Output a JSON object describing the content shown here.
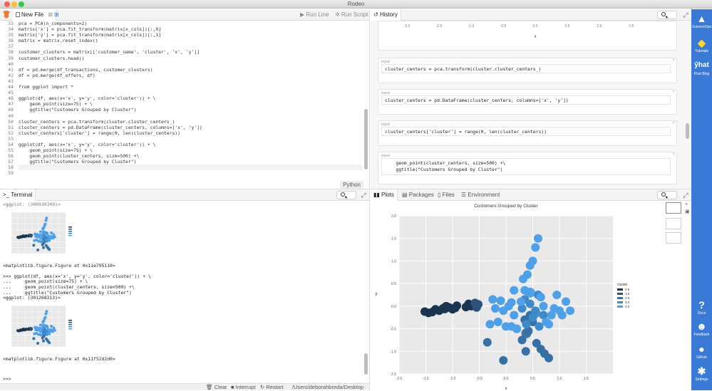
{
  "window": {
    "title": "Rodeo"
  },
  "editor": {
    "tab_label": "New File",
    "run_line": "Run Line",
    "run_script": "Run Script",
    "language": "Python",
    "lines": [
      {
        "n": "33",
        "t": "pca = PCA(n_components=2)"
      },
      {
        "n": "34",
        "t": "matrix['x'] = pca.fit_transform(matrix[x_cols])[:,0]"
      },
      {
        "n": "35",
        "t": "matrix['y'] = pca.fit_transform(matrix[x_cols])[:,1]"
      },
      {
        "n": "36",
        "t": "matrix = matrix.reset_index()"
      },
      {
        "n": "37",
        "t": ""
      },
      {
        "n": "38",
        "t": "customer_clusters = matrix[['customer_name', 'cluster', 'x', 'y']]"
      },
      {
        "n": "39",
        "t": "customer_clusters.head()"
      },
      {
        "n": "40",
        "t": ""
      },
      {
        "n": "41",
        "t": "df = pd.merge(df_transactions, customer_clusters)"
      },
      {
        "n": "42",
        "t": "df = pd.merge(df_offers, df)"
      },
      {
        "n": "43",
        "t": ""
      },
      {
        "n": "44",
        "t": "from ggplot import *"
      },
      {
        "n": "45",
        "t": ""
      },
      {
        "n": "46",
        "t": "ggplot(df, aes(x='x', y='y', color='cluster')) + \\"
      },
      {
        "n": "47",
        "t": "    geom_point(size=75) + \\"
      },
      {
        "n": "48",
        "t": "    ggtitle(\"Customers Grouped by Cluster\")"
      },
      {
        "n": "49",
        "t": ""
      },
      {
        "n": "50",
        "t": "cluster_centers = pca.transform(cluster.cluster_centers_)"
      },
      {
        "n": "51",
        "t": "cluster_centers = pd.DataFrame(cluster_centers, columns=['x', 'y'])"
      },
      {
        "n": "52",
        "t": "cluster_centers['cluster'] = range(0, len(cluster_centers))"
      },
      {
        "n": "53",
        "t": ""
      },
      {
        "n": "54",
        "t": "ggplot(df, aes(x='x', y='y', color='cluster')) + \\"
      },
      {
        "n": "55",
        "t": "    geom_point(size=75) + \\"
      },
      {
        "n": "56",
        "t": "    geom_point(cluster_centers, size=500) +\\"
      },
      {
        "n": "57",
        "t": "    ggtitle(\"Customers Grouped by Cluster\")"
      },
      {
        "n": "58",
        "t": ""
      },
      {
        "n": "59",
        "t": ""
      }
    ]
  },
  "terminal": {
    "tab_label": "Terminal",
    "top_fragment": "<ggplot: (300930349)>",
    "line_figure_1": "<matplotlib.figure.Figure at 0x11e795110>",
    "cmd_lines": [
      ">>> ggplot(df, aes(x='x', y='y', color='cluster')) + \\",
      "...     geom_point(size=75) + \\",
      "...     geom_point(cluster_centers, size=500) +\\",
      "...     ggtitle(\"Customers Grouped by Cluster\")",
      "<ggplot: (301268313)>"
    ],
    "line_figure_2": "<matplotlib.figure.Figure at 0x11f52d2d0>",
    "prompt": ">>>",
    "footer": {
      "clear": "Clear",
      "interrupt": "Interrupt",
      "restart": "Restart",
      "cwd": "/Users/deborahbreda/Desktop"
    }
  },
  "history": {
    "tab_label": "History",
    "axis_fragment": "x",
    "cells": [
      {
        "label": "input",
        "code": "cluster_centers = pca.transform(cluster.cluster_centers_)"
      },
      {
        "label": "input",
        "code": "cluster_centers = pd.DataFrame(cluster_centers, columns=['x', 'y'])"
      },
      {
        "label": "input",
        "code": "cluster_centers['cluster'] = range(0, len(cluster_centers))"
      },
      {
        "label": "input",
        "code": "    geom_point(cluster_centers, size=500) +\\\n    ggtitle(\"Customers Grouped by Cluster\")"
      },
      {
        "label": "image",
        "code": ""
      }
    ]
  },
  "plots": {
    "tabs": [
      "Plots",
      "Packages",
      "Files",
      "Environment"
    ]
  },
  "sidebar": {
    "items": [
      {
        "label": "ScienceOps",
        "icon": "scienceops-icon"
      },
      {
        "label": "Tutorials",
        "icon": "python-icon"
      },
      {
        "label": "Post Blog",
        "icon": "yhat-icon"
      },
      {
        "label": "Docs",
        "icon": "question-icon"
      },
      {
        "label": "Feedback",
        "icon": "people-icon"
      },
      {
        "label": "Github",
        "icon": "github-icon"
      },
      {
        "label": "Settings",
        "icon": "gear-icon"
      }
    ],
    "yhat_text": "ŷhat"
  },
  "colors": {
    "accent": "#3b79d6",
    "cluster0": "#1b3550",
    "cluster1": "#2a527a",
    "cluster2": "#3670a4",
    "cluster3": "#3f8acb",
    "cluster4": "#4ea0e8"
  },
  "chart_data": {
    "type": "scatter",
    "title": "Customers Grouped by Cluster",
    "xlabel": "x",
    "ylabel": "y",
    "xlim": [
      -2.0,
      2.0
    ],
    "ylim": [
      -1.5,
      2.0
    ],
    "xticks": [
      "-2.0",
      "-1.5",
      "-1.0",
      "-0.5",
      "0.0",
      "0.5",
      "1.0",
      "1.5"
    ],
    "yticks": [
      "-1.5",
      "-1.0",
      "-0.5",
      "0.0",
      "0.5",
      "1.0",
      "1.5",
      "2.0"
    ],
    "legend_title": "cluster",
    "legend": [
      "0.0",
      "1.0",
      "2.0",
      "3.0",
      "4.0"
    ],
    "legend_position": "right",
    "series": [
      {
        "name": "0.0",
        "points": [
          [
            -1.52,
            -0.12
          ],
          [
            -1.45,
            -0.15
          ],
          [
            -1.38,
            -0.13
          ],
          [
            -1.32,
            -0.07
          ],
          [
            -1.25,
            -0.1
          ],
          [
            -1.18,
            -0.05
          ],
          [
            -1.12,
            -0.0
          ],
          [
            -1.06,
            -0.03
          ],
          [
            -1.0,
            -0.07
          ],
          [
            -0.95,
            -0.04
          ],
          [
            -0.92,
            0.01
          ],
          [
            -0.75,
            -0.02
          ],
          [
            -0.7,
            0.05
          ],
          [
            -0.65,
            0.0
          ]
        ]
      },
      {
        "name": "1.0",
        "points": [
          [
            -0.58,
            0.07
          ],
          [
            -0.55,
            -0.03
          ],
          [
            -0.52,
            0.04
          ]
        ]
      },
      {
        "name": "2.0",
        "points": [
          [
            -0.35,
            -0.8
          ],
          [
            -0.05,
            -1.2
          ],
          [
            0.2,
            -0.5
          ],
          [
            0.3,
            -0.75
          ],
          [
            0.37,
            -1.0
          ],
          [
            0.42,
            -0.55
          ],
          [
            0.5,
            -0.35
          ],
          [
            0.57,
            -0.82
          ],
          [
            0.65,
            -0.95
          ],
          [
            0.72,
            -1.05
          ],
          [
            0.8,
            -1.15
          ],
          [
            0.35,
            -0.3
          ],
          [
            0.45,
            -0.2
          ]
        ]
      },
      {
        "name": "3.0",
        "points": [
          [
            0.3,
            -0.05
          ],
          [
            0.35,
            0.15
          ],
          [
            0.45,
            0.05
          ],
          [
            0.55,
            -0.1
          ],
          [
            0.6,
            0.25
          ],
          [
            0.38,
            -0.4
          ],
          [
            0.5,
            -0.25
          ],
          [
            0.62,
            -0.45
          ],
          [
            0.7,
            -0.2
          ]
        ]
      },
      {
        "name": "4.0",
        "points": [
          [
            -0.25,
            0.15
          ],
          [
            -0.2,
            -0.05
          ],
          [
            -0.1,
            0.12
          ],
          [
            -0.05,
            -0.1
          ],
          [
            0.05,
            0.0
          ],
          [
            0.1,
            0.08
          ],
          [
            0.15,
            -0.2
          ],
          [
            0.2,
            -0.5
          ],
          [
            0.28,
            0.1
          ],
          [
            0.32,
            0.6
          ],
          [
            0.35,
            0.35
          ],
          [
            0.4,
            0.7
          ],
          [
            0.42,
            0.3
          ],
          [
            0.45,
            0.9
          ],
          [
            0.5,
            1.0
          ],
          [
            0.55,
            1.3
          ],
          [
            0.6,
            1.5
          ],
          [
            0.65,
            0.2
          ],
          [
            0.7,
            0.0
          ],
          [
            0.75,
            -0.35
          ],
          [
            0.8,
            -0.4
          ],
          [
            0.85,
            -0.2
          ],
          [
            0.9,
            -0.05
          ],
          [
            0.95,
            0.25
          ],
          [
            1.0,
            -0.1
          ],
          [
            1.05,
            -0.2
          ],
          [
            1.12,
            0.1
          ],
          [
            1.2,
            -0.1
          ],
          [
            -0.3,
            -0.4
          ],
          [
            -0.15,
            -0.35
          ],
          [
            0.0,
            -0.45
          ],
          [
            0.1,
            -0.45
          ],
          [
            0.15,
            0.35
          ]
        ]
      }
    ],
    "centers": [
      [
        -1.15,
        -0.05
      ],
      [
        -0.55,
        0.02
      ],
      [
        0.38,
        -0.6
      ],
      [
        0.55,
        -0.15
      ],
      [
        0.45,
        0.3
      ]
    ]
  }
}
